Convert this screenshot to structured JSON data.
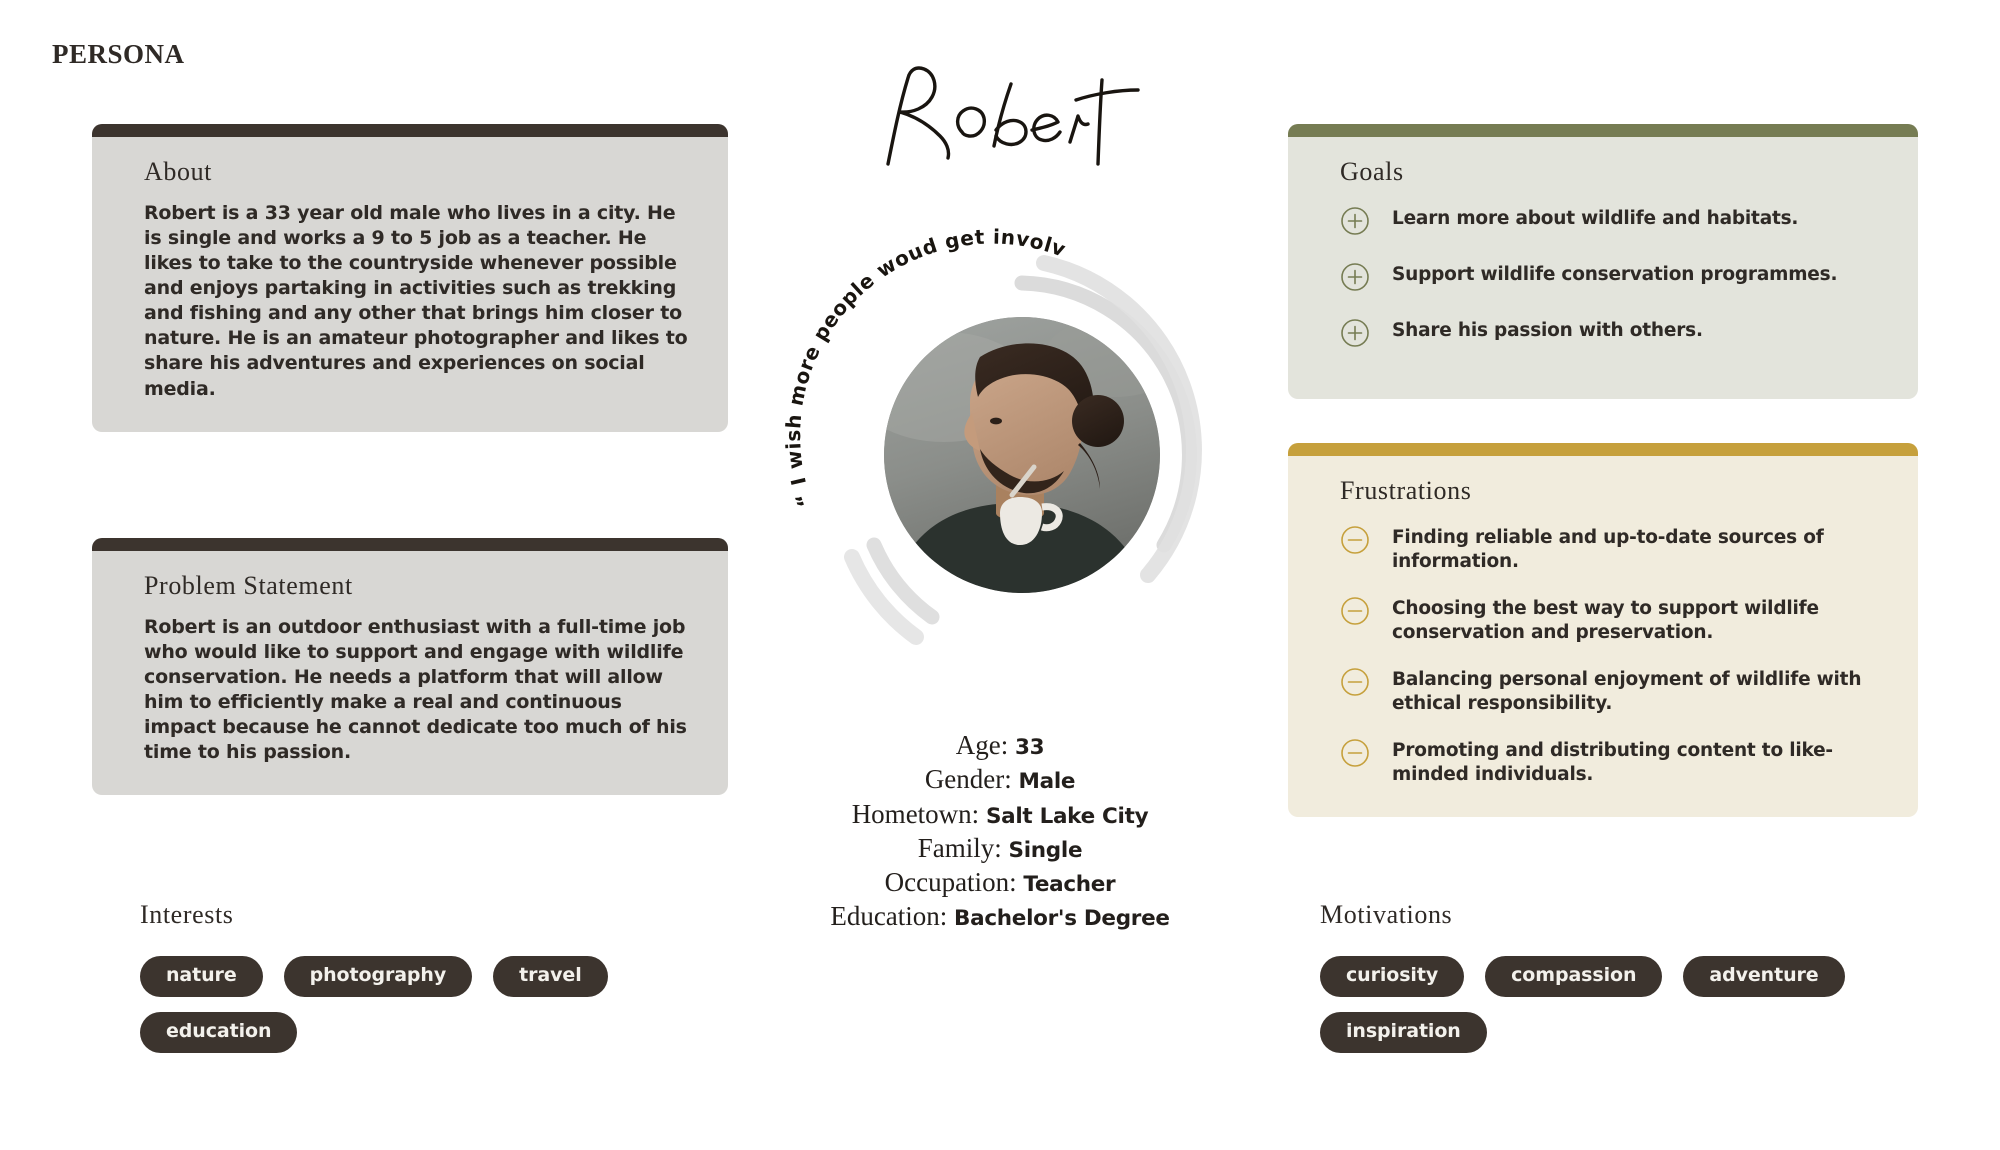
{
  "title": "Persona",
  "colors": {
    "dark": "#3c342e",
    "card_gray": "#d8d7d4",
    "goals_bar": "#767c53",
    "goals_bg": "#e3e4dc",
    "frustrations_bar": "#c6a03c",
    "frustrations_bg": "#f1ecdd",
    "tag_bg": "#3c342e",
    "tag_text": "#f3f1ec"
  },
  "about": {
    "heading": "About",
    "body": "Robert  is a 33 year old male who  lives in a city. He  is single and works a 9  to 5 job as a teacher. He  likes to take to the countryside whenever possible and enjoys  partaking in activities such as  trekking and  fishing and any other that brings him  closer to nature. He  is an amateur photographer  and likes to share his adventures and experiences on  social media."
  },
  "problem": {
    "heading": "Problem Statement",
    "body": "Robert  is an outdoor  enthusiast with a full-time job who would like to support and engage with wildlife conservation. He  needs a platform that will allow him  to efficiently make  a real and continuous impact because he cannot dedicate too much  of his time to his passion."
  },
  "goals": {
    "heading": "Goals",
    "icon": "plus-circle-icon",
    "items": [
      "Learn more about wildlife and habitats.",
      "Support wildlife conservation programmes.",
      "Share his passion with others."
    ]
  },
  "frustrations": {
    "heading": "Frustrations",
    "icon": "minus-circle-icon",
    "items": [
      "Finding reliable and up-to-date sources of information.",
      "Choosing  the best way to support wildlife conservation and preservation.",
      "Balancing personal enjoyment of wildlife with ethical responsibility.",
      "Promoting  and distributing content to like-minded  individuals."
    ]
  },
  "center": {
    "signature_name": "Robert",
    "quote": "“ I wish more people woud get involved ”",
    "avatar_alt": "portrait-photo"
  },
  "demographics": [
    {
      "label": "Age:",
      "value": "33"
    },
    {
      "label": "Gender:",
      "value": "Male"
    },
    {
      "label": "Hometown:",
      "value": "Salt Lake City"
    },
    {
      "label": "Family:",
      "value": "Single"
    },
    {
      "label": "Occupation:",
      "value": "Teacher"
    },
    {
      "label": "Education:",
      "value": "Bachelor's Degree"
    }
  ],
  "interests": {
    "title": "Interests",
    "tags": [
      "nature",
      "photography",
      "travel",
      "education"
    ]
  },
  "motivations": {
    "title": "Motivations",
    "tags": [
      "curiosity",
      "compassion",
      "adventure",
      "inspiration"
    ]
  }
}
